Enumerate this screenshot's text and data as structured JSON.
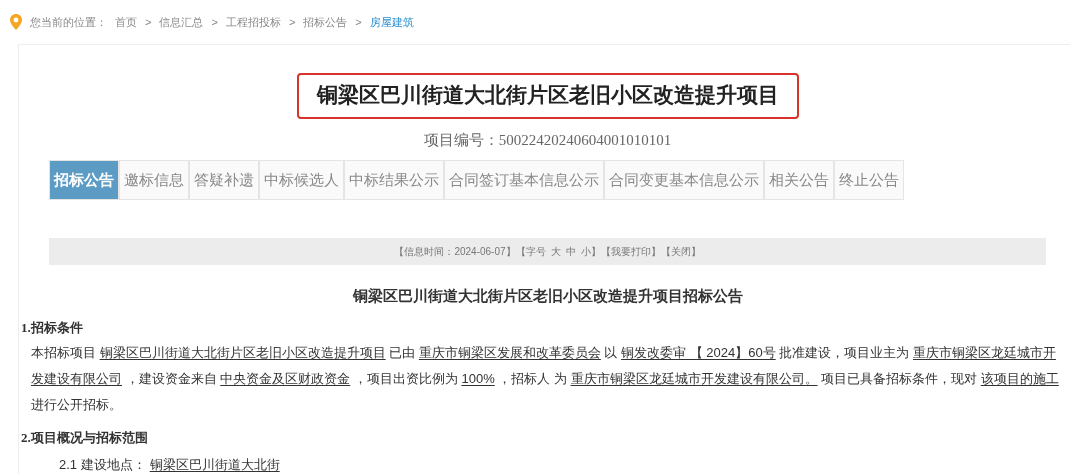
{
  "breadcrumb": {
    "label": "您当前的位置：",
    "items": [
      {
        "text": "首页",
        "current": false
      },
      {
        "text": "信息汇总",
        "current": false
      },
      {
        "text": "工程招投标",
        "current": false
      },
      {
        "text": "招标公告",
        "current": false
      },
      {
        "text": "房屋建筑",
        "current": true
      }
    ],
    "separator": ">"
  },
  "title": "铜梁区巴川街道大北街片区老旧小区改造提升项目",
  "project_no": "项目编号：50022420240604001010101",
  "tabs": [
    {
      "label": "招标公告",
      "selected": true
    },
    {
      "label": "邀标信息",
      "selected": false
    },
    {
      "label": "答疑补遗",
      "selected": false
    },
    {
      "label": "中标候选人",
      "selected": false
    },
    {
      "label": "中标结果公示",
      "selected": false
    },
    {
      "label": "合同签订基本信息公示",
      "selected": false
    },
    {
      "label": "合同变更基本信息公示",
      "selected": false
    },
    {
      "label": "相关公告",
      "selected": false
    },
    {
      "label": "终止公告",
      "selected": false
    }
  ],
  "info_bar": {
    "time": "【信息时间：2024-06-07】",
    "font_label": "【字号",
    "font_sizes": [
      "大",
      "中",
      "小"
    ],
    "font_end": "】",
    "actions": [
      "【我要打印】",
      "【关闭】"
    ]
  },
  "notice_title": "铜梁区巴川街道大北街片区老旧小区改造提升项目招标公告",
  "sections": [
    {
      "heading": "1.招标条件",
      "paragraph": [
        {
          "text": "本招标项目 ",
          "underlined": false
        },
        {
          "text": "铜梁区巴川街道大北街片区老旧小区改造提升项目",
          "underlined": true
        },
        {
          "text": " 已由 ",
          "underlined": false
        },
        {
          "text": "重庆市铜梁区发展和改革委员会",
          "underlined": true
        },
        {
          "text": " 以 ",
          "underlined": false
        },
        {
          "text": "铜发改委审 【 2024】60号",
          "underlined": true
        },
        {
          "text": " 批准建设，项目业主为 ",
          "underlined": false
        },
        {
          "text": "重庆市铜梁区龙廷城市开发建设有限公司",
          "underlined": true
        },
        {
          "text": " ，建设资金来自 ",
          "underlined": false
        },
        {
          "text": "中央资金及区财政资金",
          "underlined": true
        },
        {
          "text": " ，项目出资比例为 ",
          "underlined": false
        },
        {
          "text": "100%",
          "underlined": true
        },
        {
          "text": " ，招标人 为 ",
          "underlined": false
        },
        {
          "text": "重庆市铜梁区龙廷城市开发建设有限公司。",
          "underlined": true
        },
        {
          "text": " 项目已具备招标条件，现对 ",
          "underlined": false
        },
        {
          "text": "该项目的施工",
          "underlined": true
        },
        {
          "text": " 进行公开招标。",
          "underlined": false
        }
      ]
    },
    {
      "heading": "2.项目概况与招标范围",
      "items": [
        {
          "label": "2.1 建设地点：",
          "value": "铜梁区巴川街道大北街"
        }
      ]
    }
  ]
}
